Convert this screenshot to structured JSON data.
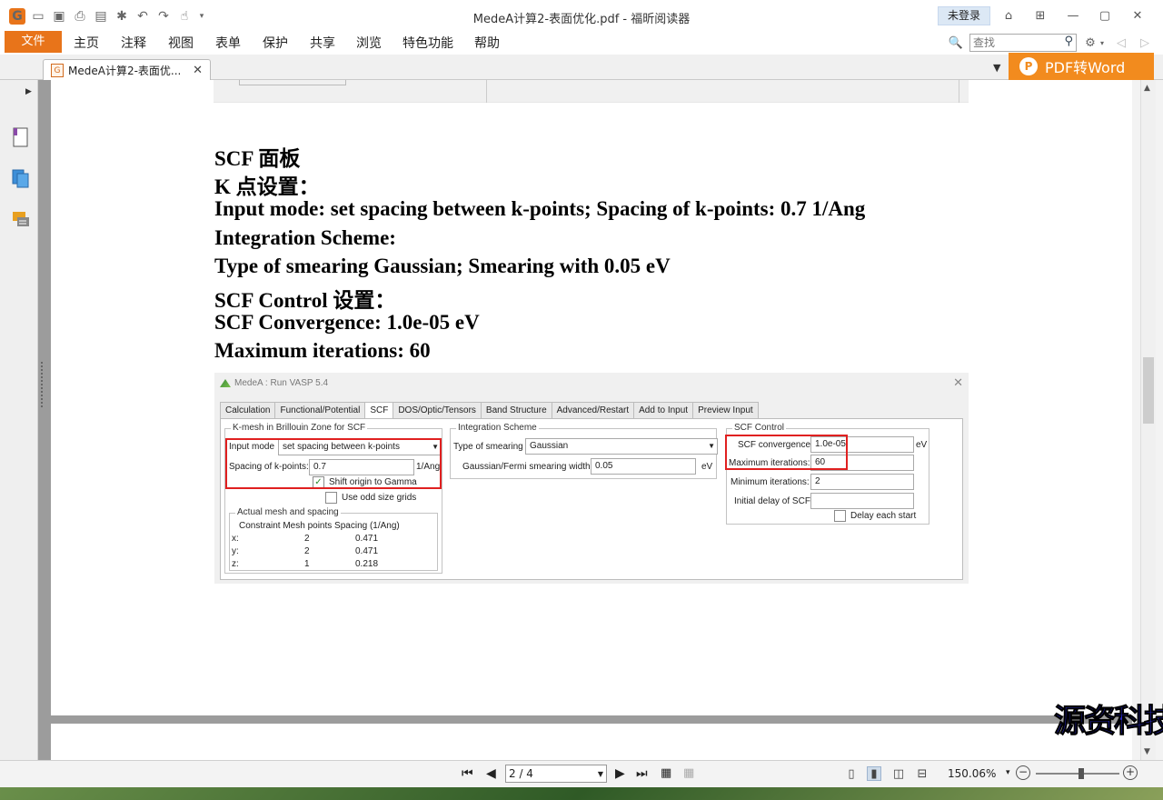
{
  "app": {
    "window_title": "MedeA计算2-表面优化.pdf - 福昕阅读器",
    "login_label": "未登录",
    "logo_letter": "G"
  },
  "menu": {
    "file": "文件",
    "items": [
      "主页",
      "注释",
      "视图",
      "表单",
      "保护",
      "共享",
      "浏览",
      "特色功能",
      "帮助"
    ]
  },
  "search": {
    "placeholder": "查找"
  },
  "tab": {
    "label": "MedeA计算2-表面优..."
  },
  "promo": {
    "label": "PDF转Word"
  },
  "document": {
    "lines": [
      "SCF 面板",
      "K 点设置：",
      "Input mode: set spacing between k-points; Spacing of k-points: 0.7 1/Ang",
      "Integration Scheme:",
      "Type of smearing Gaussian; Smearing with 0.05 eV",
      "SCF Control 设置：",
      "SCF Convergence: 1.0e-05 eV",
      "Maximum iterations: 60"
    ]
  },
  "screenshot": {
    "title": "MedeA : Run VASP 5.4",
    "close": "✕",
    "tabs": [
      "Calculation",
      "Functional/Potential",
      "SCF",
      "DOS/Optic/Tensors",
      "Band Structure",
      "Advanced/Restart",
      "Add to Input",
      "Preview Input"
    ],
    "active_tab": "SCF",
    "kmesh": {
      "title": "K-mesh in Brillouin Zone for SCF",
      "input_mode_label": "Input mode",
      "input_mode_value": "set spacing between k-points",
      "spacing_label": "Spacing of k-points:",
      "spacing_value": "0.7",
      "spacing_unit": "1/Ang",
      "shift_origin": "Shift origin to Gamma",
      "odd_grids": "Use odd size grids",
      "actual": {
        "title": "Actual mesh and spacing",
        "header": "Constraint Mesh points Spacing (1/Ang)",
        "rows": [
          {
            "axis": "x:",
            "mesh": "2",
            "spacing": "0.471"
          },
          {
            "axis": "y:",
            "mesh": "2",
            "spacing": "0.471"
          },
          {
            "axis": "z:",
            "mesh": "1",
            "spacing": "0.218"
          }
        ]
      }
    },
    "integration": {
      "title": "Integration Scheme",
      "smearing_label": "Type of smearing",
      "smearing_value": "Gaussian",
      "width_label": "Gaussian/Fermi smearing width:",
      "width_value": "0.05",
      "width_unit": "eV"
    },
    "scf_control": {
      "title": "SCF Control",
      "convergence_label": "SCF convergence:",
      "convergence_value": "1.0e-05",
      "convergence_unit": "eV",
      "max_iter_label": "Maximum iterations:",
      "max_iter_value": "60",
      "min_iter_label": "Minimum iterations:",
      "min_iter_value": "2",
      "delay_label": "Initial delay of SCF:",
      "delay_value": "",
      "delay_each": "Delay each start"
    }
  },
  "status": {
    "page_indicator": "2 / 4",
    "zoom": "150.06%"
  },
  "watermark": "源资科技"
}
